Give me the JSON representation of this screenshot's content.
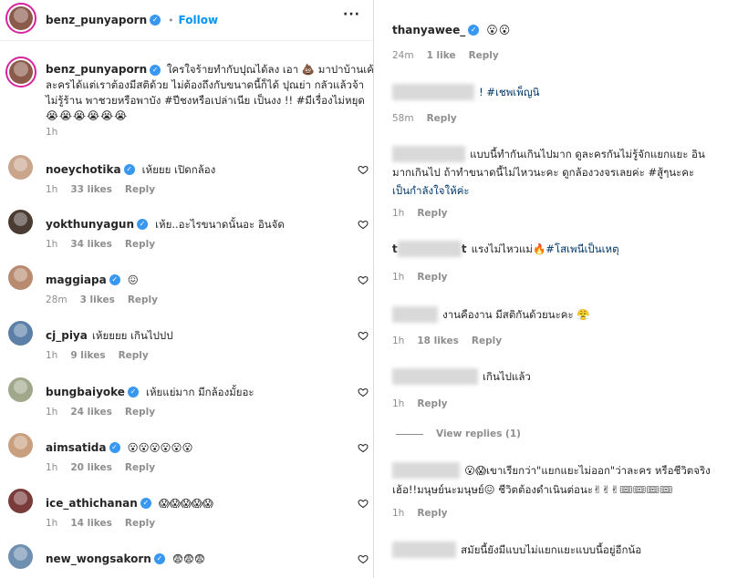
{
  "post": {
    "username": "benz_punyaporn",
    "separator": "•",
    "follow_label": "Follow",
    "more_icon": "more-dots",
    "caption_lines": [
      "ใครใจร้ายทำกับปุณได้ลง เอา 💩 มาปาบ้านเค้า อิน",
      "ละครได้แต่เราต้องมีสติด้วย ไม่ต้องถึงกับขนาดนี้ก็ได้ ปุณย่า กลัวแล้วจ้า ",
      "ไม่รู้ร้าน พาชวยหรือพาบัง #ปีชงหรือเปล่าเนีย เป็นงง !! #มีเรื่องไม่หยุด",
      "😭😭😭😭😭😭"
    ],
    "time": "1h"
  },
  "left_comments": [
    {
      "user": "noeychotika",
      "verified": true,
      "text": "เห้ยยย เปิดกล้อง",
      "time": "1h",
      "likes": "33 likes",
      "reply": "Reply",
      "color": "#c9a58c"
    },
    {
      "user": "yokthunyagun",
      "verified": true,
      "text": "เห้ย..อะไรขนาดนั้นอะ อินจัด",
      "time": "1h",
      "likes": "34 likes",
      "reply": "Reply",
      "color": "#4a3b33"
    },
    {
      "user": "maggiapa",
      "verified": true,
      "text": "😖",
      "time": "28m",
      "likes": "3 likes",
      "reply": "Reply",
      "color": "#b88a70"
    },
    {
      "user": "cj_piya",
      "verified": false,
      "text": "เห้ยยยย เกินไปปป",
      "time": "1h",
      "likes": "9 likes",
      "reply": "Reply",
      "color": "#5b7fa6"
    },
    {
      "user": "bungbaiyoke",
      "verified": true,
      "text": "เห้ยแย่มาก มีกล้องมั้ยอะ",
      "time": "1h",
      "likes": "24 likes",
      "reply": "Reply",
      "color": "#9fa88a"
    },
    {
      "user": "aimsatida",
      "verified": true,
      "text": "😮😮😮😮😮😮",
      "time": "1h",
      "likes": "20 likes",
      "reply": "Reply",
      "color": "#c8a080"
    },
    {
      "user": "ice_athichanan",
      "verified": true,
      "text": "😱😱😱😱😱",
      "time": "1h",
      "likes": "14 likes",
      "reply": "Reply",
      "color": "#7a3b3b"
    },
    {
      "user": "new_wongsakorn",
      "verified": true,
      "text": "😨😨😨",
      "time": "",
      "likes": "",
      "reply": "",
      "color": "#6f8fb0"
    }
  ],
  "right": {
    "top_user": "thanyawee_",
    "top_text": "😮😮",
    "top_time": "24m",
    "top_likes": "1 like",
    "top_reply": "Reply",
    "c1_text": "! #เชพเพ็ญนิ",
    "c1_time": "58m",
    "c1_reply": "Reply",
    "c2_lines": [
      "แบบนี้ทำกันเกินไปมาก ดูละครกันไม่รู้จักแยกแยะ อิน",
      "มากเกินไป ถ้าทำขนาดนี้ไม่ไหวนะคะ ดูกล้องวงจรเลยค่ะ #สู้ๆนะคะ",
      "เป็นกำลังใจให้ค่ะ"
    ],
    "c2_time": "1h",
    "c2_reply": "Reply",
    "c3_user_start": "t",
    "c3_user_end": "t",
    "c3_text": "แรงไม่ไหวแม่🔥",
    "c3_hashtag": "#โสเพนีเป็นเหตุ",
    "c3_time": "1h",
    "c3_reply": "Reply",
    "c4_text": "งานคืองาน มีสติกันด้วยนะคะ 😤",
    "c4_time": "1h",
    "c4_likes": "18 likes",
    "c4_reply": "Reply",
    "c5_text": "เกินไปแล้ว",
    "c5_time": "1h",
    "c5_reply": "Reply",
    "view_replies": "View replies (1)",
    "c6_line1": "😮😱เขาเรียกว่า\"แยกแยะไม่ออก\"ว่าละคร หรือชีวิตจริง",
    "c6_line2": "เฮ้อ!!มนุษย์นะมนุษย์😖 ชีวิตต้องดำเนินต่อนะ✌✌✌🎟🎟🎟🎟",
    "c6_time": "1h",
    "c6_reply": "Reply",
    "c7_text": "สมัยนี้ยังมีแบบไม่แยกแยะแบบนี้อยู่อีกน้อ"
  }
}
